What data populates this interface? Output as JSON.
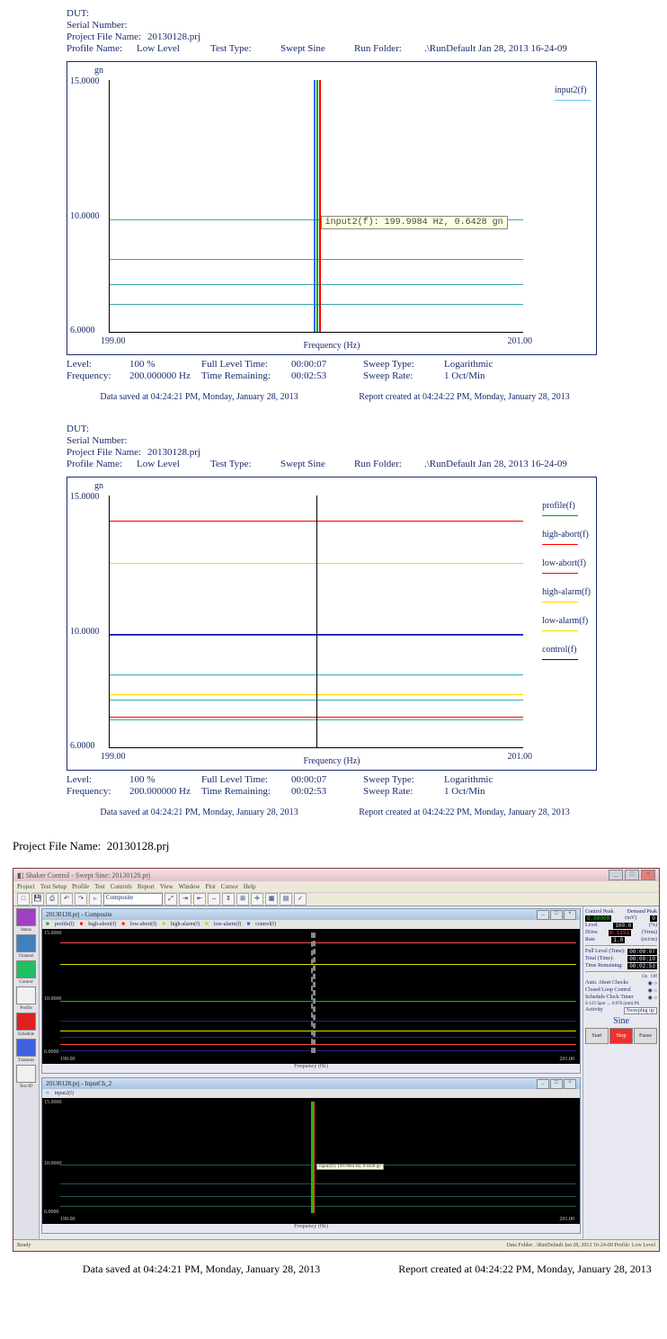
{
  "header": {
    "dut_label": "DUT:",
    "serial_label": "Serial Number:",
    "project_label": "Project File Name:",
    "project_value": "20130128.prj",
    "profile_label": "Profile Name:",
    "profile_value": "Low Level",
    "testtype_label": "Test Type:",
    "testtype_value": "Swept Sine",
    "runfolder_label": "Run Folder:",
    "runfolder_value": ".\\RunDefault Jan 28, 2013 16-24-09"
  },
  "status": {
    "level_label": "Level:",
    "level_value": "100 %",
    "fulltime_label": "Full Level Time:",
    "fulltime_value": "00:00:07",
    "sweeptype_label": "Sweep Type:",
    "sweeptype_value": "Logarithmic",
    "freq_label": "Frequency:",
    "freq_value": "200.000000 Hz",
    "remaining_label": "Time Remaining:",
    "remaining_value": "00:02:53",
    "sweeprate_label": "Sweep Rate:",
    "sweeprate_value": "1 Oct/Min"
  },
  "timestamps": {
    "saved": "Data saved at 04:24:21 PM, Monday, January 28, 2013",
    "report": "Report created at 04:24:22 PM, Monday, January 28, 2013"
  },
  "chart_data": [
    {
      "type": "line",
      "title": "gn",
      "xlabel": "Frequency (Hz)",
      "xlim": [
        199.0,
        201.0
      ],
      "ylim": [
        6.0,
        15.0
      ],
      "y_ticks": [
        6.0,
        10.0,
        15.0
      ],
      "x_ticks": [
        199.0,
        201.0
      ],
      "gridlines_y": [
        7.0,
        7.7,
        8.6,
        10.0
      ],
      "cursor": {
        "x": 200.0,
        "lines": [
          "green",
          "red",
          "blue"
        ]
      },
      "tooltip": "input2(f): 199.9984 Hz, 0.6428 gn",
      "series": [
        {
          "name": "input2(f)",
          "color": "#66ccff",
          "values_at_cursor": 0.6428
        }
      ],
      "legend": [
        "input2(f)"
      ]
    },
    {
      "type": "line",
      "title": "gn",
      "xlabel": "Frequency (Hz)",
      "xlim": [
        199.0,
        201.0
      ],
      "ylim": [
        6.0,
        15.0
      ],
      "y_ticks": [
        6.0,
        10.0,
        15.0
      ],
      "x_ticks": [
        199.0,
        201.0
      ],
      "cursor": {
        "x": 200.0,
        "lines": [
          "black"
        ]
      },
      "series": [
        {
          "name": "profile(f)",
          "color": "#00a000",
          "y": 10.0
        },
        {
          "name": "high-abort(f)",
          "color": "#ff0000",
          "y": 14.1
        },
        {
          "name": "low-abort(f)",
          "color": "#ff0000",
          "y": 7.1
        },
        {
          "name": "high-alarm(f)",
          "color": "#ffd800",
          "y": 12.6
        },
        {
          "name": "low-alarm(f)",
          "color": "#ffd800",
          "y": 7.9
        },
        {
          "name": "control(f)",
          "color": "#0000cc",
          "y": 10.0
        }
      ],
      "gridlines_y": [
        7.0,
        7.7,
        8.6,
        10.0
      ],
      "legend": [
        "profile(f)",
        "high-abort(f)",
        "low-abort(f)",
        "high-alarm(f)",
        "low-alarm(f)",
        "control(f)"
      ]
    }
  ],
  "bottom_project": {
    "label": "Project File Name:",
    "value": "20130128.prj"
  },
  "app": {
    "title": "Shaker Control - Swept Sine: 20130128.prj",
    "menu": [
      "Project",
      "Test Setup",
      "Profile",
      "Test",
      "Controls",
      "Report",
      "View",
      "Window",
      "Plot",
      "Cursor",
      "Help"
    ],
    "dropdown": "Composite",
    "sidebar": [
      "Status",
      "Channel",
      "Control",
      "Profile",
      "Sched",
      "Schedule",
      "Transmis",
      "Test ID"
    ],
    "win1_title": "20130128.prj - Composite",
    "win1_legend": [
      "profile(f)",
      "high-abort(f)",
      "low-abort(f)",
      "high-alarm(f)",
      "low-alarm(f)",
      "control(f)"
    ],
    "win2_title": "20130128.prj - InputCh_2",
    "win2_legend": [
      "input2(f)"
    ],
    "plot_ylabel_top": "15.0000",
    "plot_ylabel_mid": "10.0000",
    "plot_ylabel_bot": "6.0000",
    "plot_xleft": "199.00",
    "plot_xright": "201.00",
    "plot_xlabel": "Frequency (Hz)",
    "tooltip": "input2(f): 199.9984 Hz, 0.6428 gn",
    "right": {
      "ctrl_peak": "Control Peak",
      "ctrl_peak_v": "0.00000",
      "dem_peak": "Demand Peak",
      "dem_peak_v": "0",
      "unit": "(mV)",
      "level_l": "Level",
      "level_v": "100.0",
      "level_u": "(%)",
      "drive_l": "Drive",
      "drive_v": "0.1152",
      "drive_u": "(Vrms)",
      "rate_l": "Rate",
      "rate_v": "1.0",
      "rate_u": "(oct/m)",
      "full_l": "Full Level (Time):",
      "full_v": "00:00:07",
      "total_l": "Total (Time):",
      "total_v": "00:00:10",
      "remain_l": "Time Remaining:",
      "remain_v": "00:02:53",
      "auto_l": "Auto. Abort Checks",
      "closed_l": "Closed Loop Control",
      "sched_l": "Schedule Clock Timer",
      "spot": "S-125 Spot ↔ 0.076 (mm) Pk",
      "activity": "Activity",
      "activity_v": "Sweeping up",
      "sine": "Sine",
      "start": "Start",
      "stop": "Stop",
      "pause": "Pause"
    },
    "statusbar_left": "Ready",
    "statusbar_right": "Data Folder: .\\RunDefault Jan 28, 2013 16-24-09    Profile: Low Level"
  }
}
